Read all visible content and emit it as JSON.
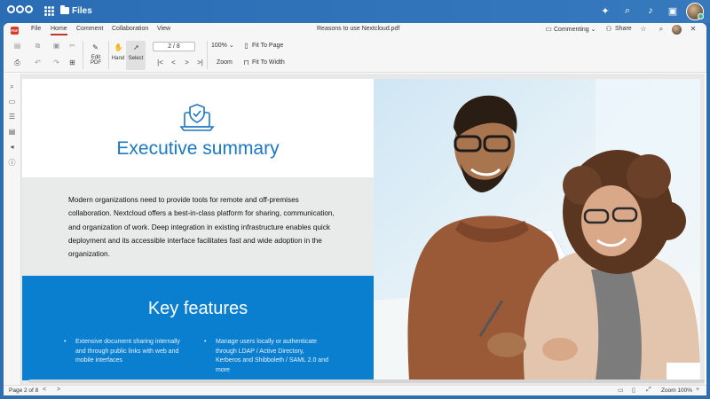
{
  "nextcloud": {
    "app_name": "Files",
    "icons": [
      "nextcloud-logo-icon",
      "apps-grid-icon",
      "folder-icon",
      "sparkle-icon",
      "search-icon",
      "notifications-icon",
      "contacts-icon",
      "user-avatar"
    ]
  },
  "viewer": {
    "menu": [
      "File",
      "Home",
      "Comment",
      "Collaboration",
      "View"
    ],
    "active_menu": "Home",
    "document_title": "Reasons to use Nextcloud.pdf",
    "mode_label": "Commenting",
    "share_label": "Share",
    "toolbar": {
      "edit_pdf": "Edit PDF",
      "hand": "Hand",
      "select": "Select",
      "page_indicator": "2 / 8",
      "zoom_value": "100%",
      "zoom_label": "Zoom",
      "fit_to_page": "Fit To Page",
      "fit_to_width": "Fit To Width"
    },
    "status": {
      "page_of": "Page 2 of 8",
      "zoom": "Zoom 100%"
    }
  },
  "document": {
    "executive_title": "Executive summary",
    "summary_text": "Modern organizations need to provide tools for remote and off-premises collaboration. Nextcloud offers a best-in-class platform for sharing, communication, and organization of work. Deep integration in existing infrastructure enables quick deployment and its accessible interface facilitates fast and wide adoption in the organization.",
    "key_features_title": "Key features",
    "features": [
      "Extensive document sharing internally and through public links with web and mobile interfaces",
      "Manage users locally or authenticate through LDAP / Active Directory, Kerberos and Shibboleth / SAML 2.0 and more"
    ]
  },
  "colors": {
    "nextcloud_blue": "#2a6db5",
    "heading_blue": "#1d77c2",
    "key_features_bg": "#0b7fcf",
    "summary_bg": "#e9eaea",
    "pdf_red": "#d93a2b"
  }
}
